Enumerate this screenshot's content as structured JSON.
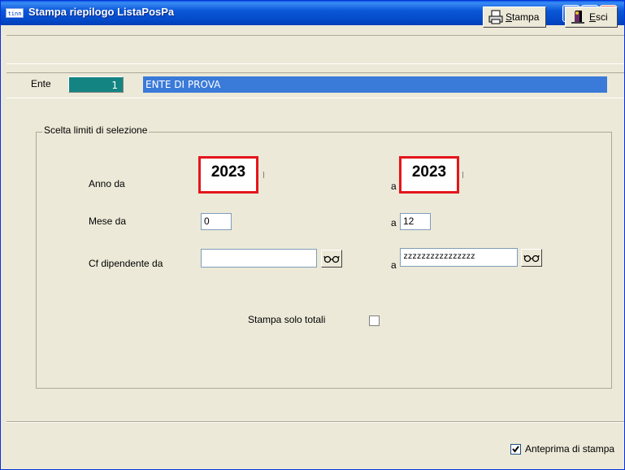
{
  "window": {
    "app_icon_text": "tinn",
    "title": "Stampa riepilogo ListaPosPa"
  },
  "toolbar": {
    "print_label_accel": "S",
    "print_label_rest": "tampa",
    "exit_label_accel": "E",
    "exit_label_rest": "sci"
  },
  "ente": {
    "label": "Ente",
    "code": "1",
    "name": "ENTE DI PROVA"
  },
  "selection": {
    "group_title": "Scelta limiti di selezione",
    "year": {
      "label_from": "Anno da",
      "value_from": "2023",
      "label_to": "a",
      "value_to": "2023"
    },
    "month": {
      "label_from": "Mese da",
      "value_from": "0",
      "label_to": "a",
      "value_to": "12"
    },
    "cf": {
      "label_from": "Cf dipendente da",
      "value_from": "",
      "label_to": "a",
      "value_to": "zzzzzzzzzzzzzzzz"
    },
    "only_totals": {
      "label": "Stampa solo totali",
      "checked": false
    }
  },
  "footer": {
    "preview_label": "Anteprima di stampa",
    "preview_checked": true
  }
}
